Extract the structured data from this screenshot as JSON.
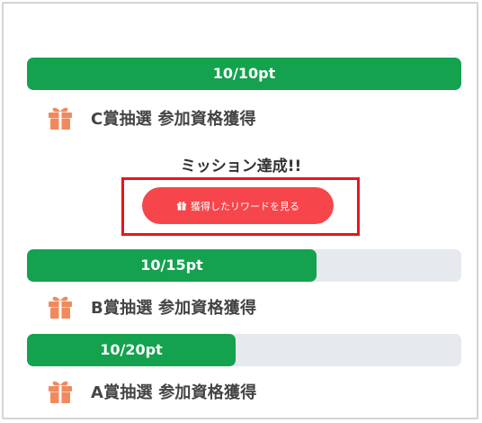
{
  "tiers": [
    {
      "progress_text": "10/10pt",
      "fill_fraction": 1.0,
      "reward_label": "C賞抽選 参加資格獲得"
    },
    {
      "progress_text": "10/15pt",
      "fill_fraction": 0.6667,
      "reward_label": "B賞抽選 参加資格獲得"
    },
    {
      "progress_text": "10/20pt",
      "fill_fraction": 0.5,
      "reward_label": "A賞抽選 参加資格獲得"
    }
  ],
  "mission": {
    "status_text": "ミッション達成!!",
    "button_label": "獲得したリワードを見る"
  },
  "icons": {
    "reward": "gift-icon",
    "button": "gift-icon"
  },
  "colors": {
    "progress_fill": "#14a24f",
    "progress_track": "#e6e9ed",
    "button_bg": "#f6454b",
    "highlight_border": "#e8151d",
    "gift_icon": "#f08a5d"
  }
}
